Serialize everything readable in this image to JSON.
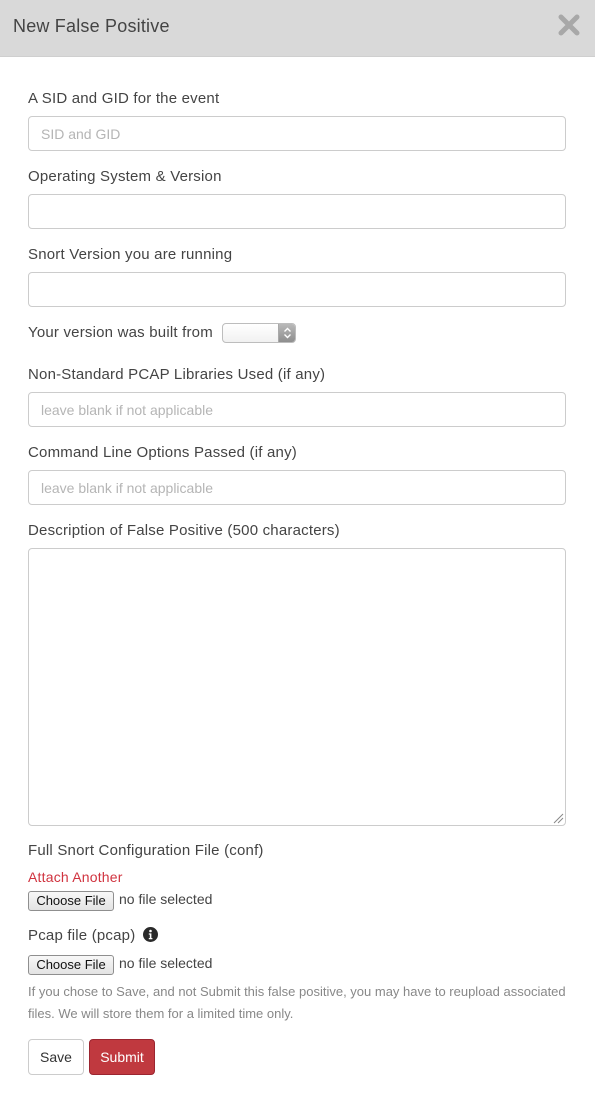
{
  "modal": {
    "title": "New False Positive"
  },
  "form": {
    "sid_gid": {
      "label": "A SID and GID for the event",
      "placeholder": "SID and GID",
      "value": ""
    },
    "os_version": {
      "label": "Operating System & Version",
      "placeholder": "",
      "value": ""
    },
    "snort_version": {
      "label": "Snort Version you are running",
      "placeholder": "",
      "value": ""
    },
    "built_from": {
      "label": "Your version was built from",
      "selected": ""
    },
    "pcap_libraries": {
      "label": "Non-Standard PCAP Libraries Used (if any)",
      "placeholder": "leave blank if not applicable",
      "value": ""
    },
    "command_line": {
      "label": "Command Line Options Passed (if any)",
      "placeholder": "leave blank if not applicable",
      "value": ""
    },
    "description": {
      "label": "Description of False Positive (500 characters)",
      "placeholder": "",
      "value": ""
    },
    "config_file": {
      "label": "Full Snort Configuration File (conf)",
      "attach_another": "Attach Another",
      "button_label": "Choose File",
      "status": "no file selected"
    },
    "pcap_file": {
      "label": "Pcap file (pcap)",
      "button_label": "Choose File",
      "status": "no file selected"
    },
    "help_text": "If you chose to Save, and not Submit this false positive, you may have to reupload associated files. We will store them for a limited time only."
  },
  "actions": {
    "save_label": "Save",
    "submit_label": "Submit"
  },
  "icons": {
    "close": "close-icon",
    "info": "info-icon",
    "select_arrows": "chevron-up-down-icon",
    "resize_grip": "resize-grip-icon"
  },
  "colors": {
    "header_bg": "#d9d9d9",
    "accent_red": "#c0393f",
    "link_red": "#d0333f"
  }
}
